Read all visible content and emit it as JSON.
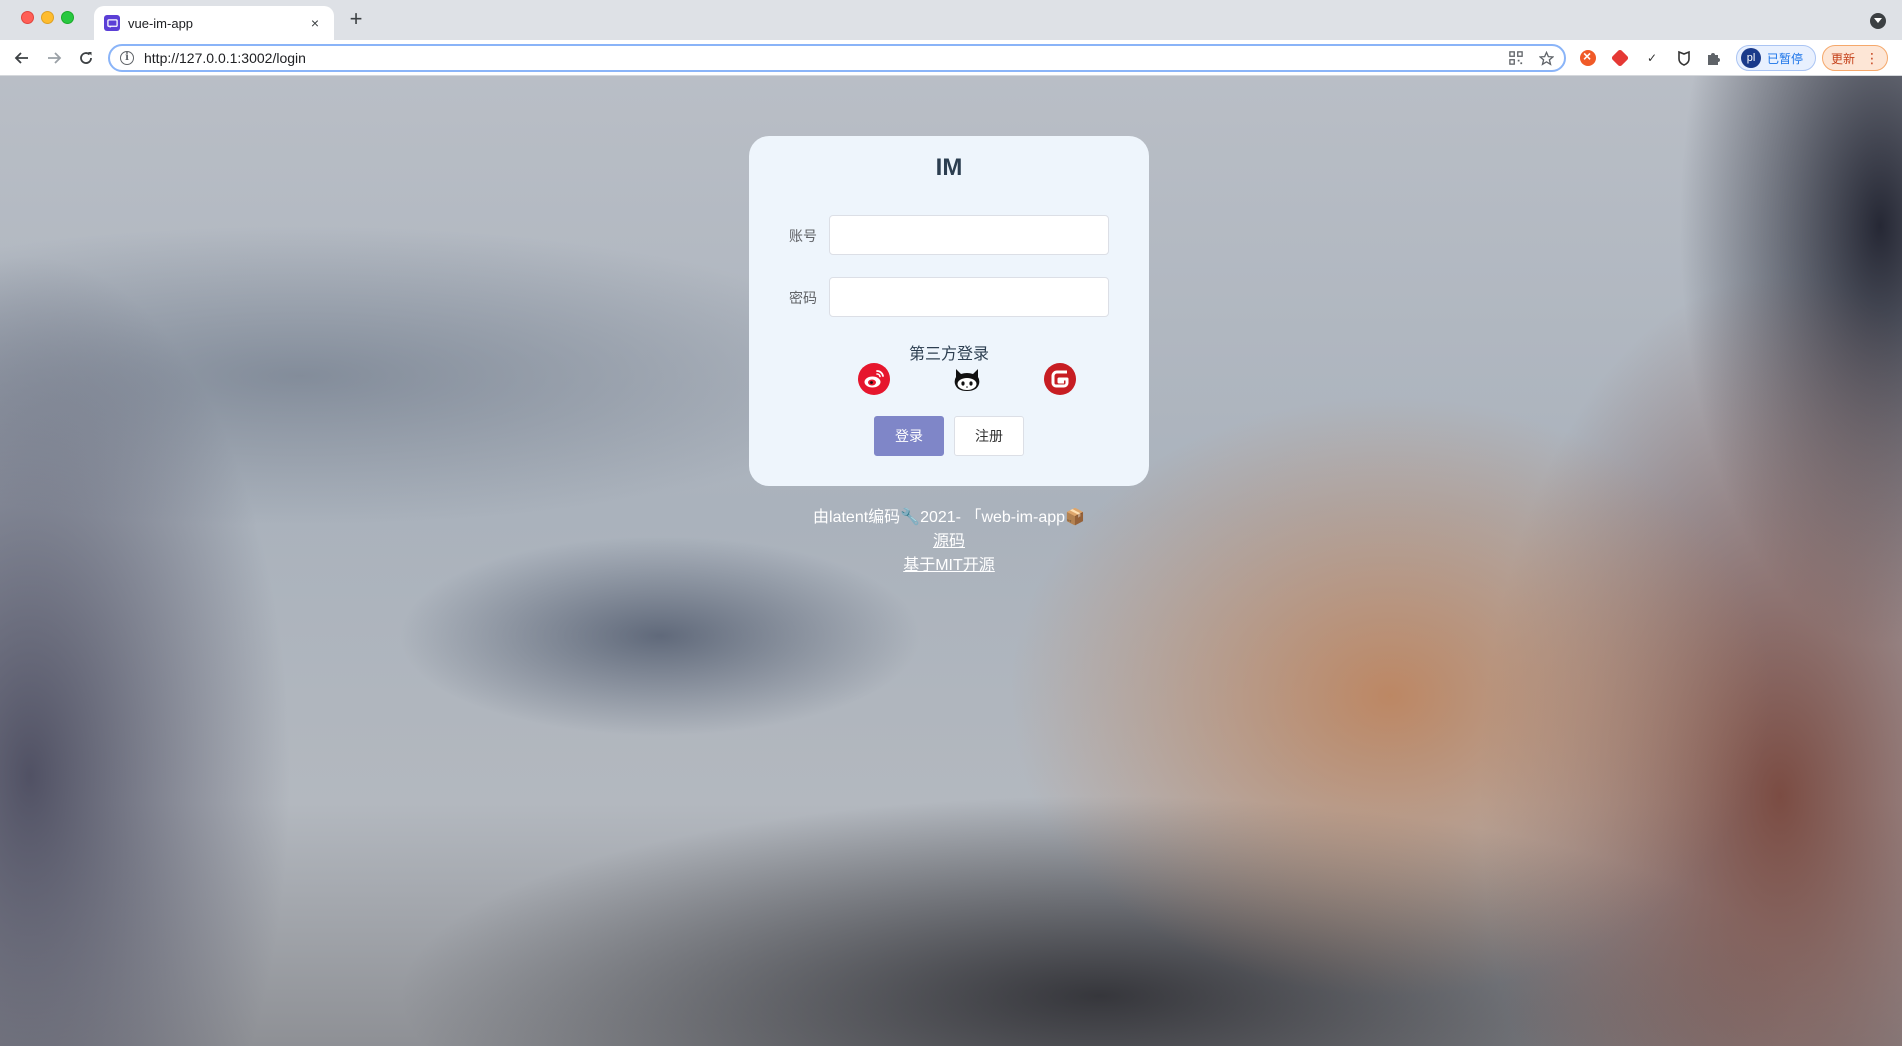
{
  "browser": {
    "tab": {
      "title": "vue-im-app",
      "close_glyph": "×"
    },
    "new_tab_glyph": "+",
    "url": "http://127.0.0.1:3002/login",
    "profile": {
      "initials": "pl",
      "label": "已暂停"
    },
    "update_label": "更新",
    "update_menu_glyph": "⋮",
    "icons": [
      "back-icon",
      "forward-icon",
      "reload-icon",
      "info-icon",
      "qr-code-icon",
      "bookmark-star-icon",
      "extension-icons",
      "puzzle-icon"
    ]
  },
  "login": {
    "title": "IM",
    "account_label": "账号",
    "account_value": "",
    "password_label": "密码",
    "password_value": "",
    "third_party_title": "第三方登录",
    "oauth_providers": [
      "weibo-icon",
      "github-icon",
      "gitee-icon"
    ],
    "login_button": "登录",
    "register_button": "注册"
  },
  "footer": {
    "credit": "由latent编码🔧2021- 「web-im-app📦",
    "source_link": "源码",
    "license_link": "基于MIT开源"
  },
  "colors": {
    "card_bg": "#eef5fc",
    "primary_button": "#7f86c8",
    "weibo": "#e6162d",
    "gitee": "#c71d23"
  }
}
